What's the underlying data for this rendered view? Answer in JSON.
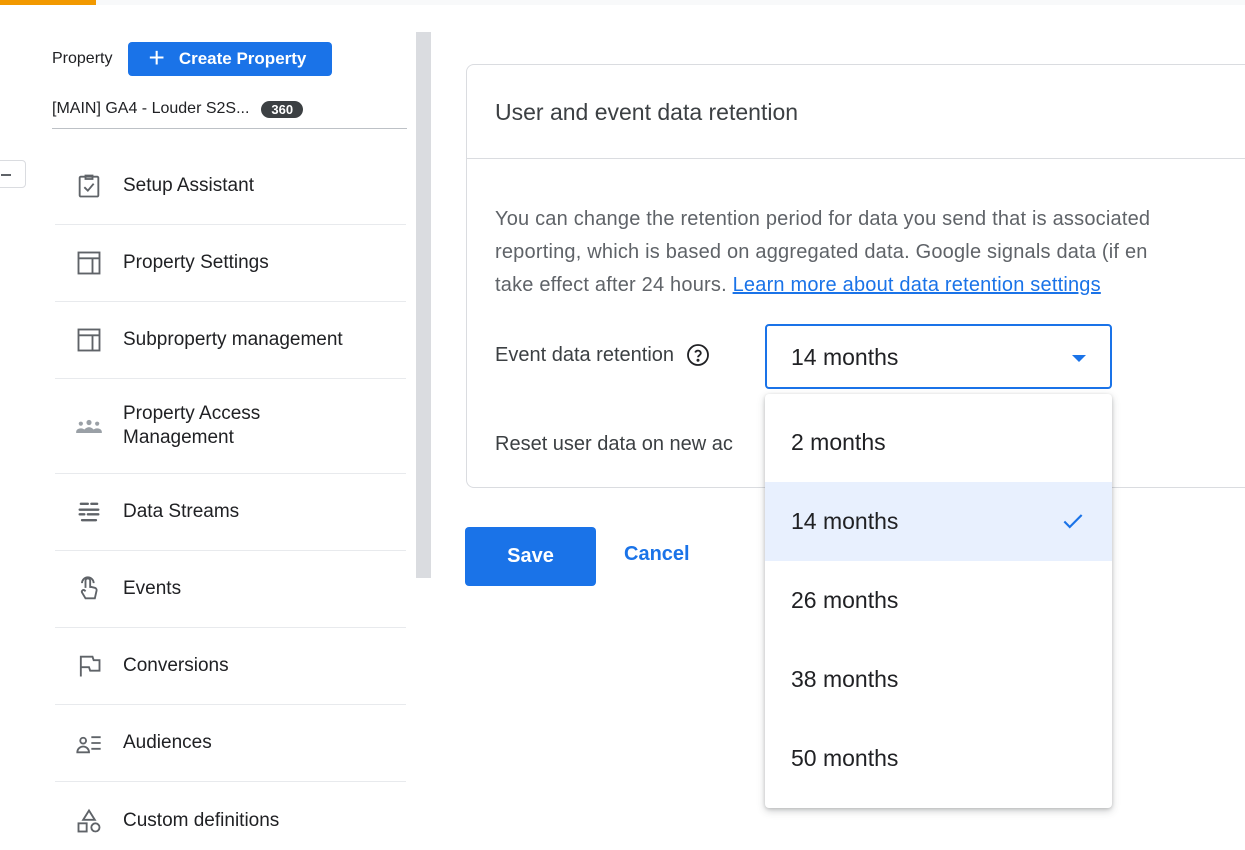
{
  "sidebar": {
    "property_label": "Property",
    "create_property_label": "Create Property",
    "property_name": "[MAIN] GA4 - Louder S2S...",
    "property_badge": "360",
    "items": [
      {
        "label": "Setup Assistant",
        "icon": "clipboard-check-icon"
      },
      {
        "label": "Property Settings",
        "icon": "layout-icon"
      },
      {
        "label": "Subproperty management",
        "icon": "layout-icon"
      },
      {
        "label": "Property Access Management",
        "icon": "people-icon"
      },
      {
        "label": "Data Streams",
        "icon": "data-streams-icon"
      },
      {
        "label": "Events",
        "icon": "touch-icon"
      },
      {
        "label": "Conversions",
        "icon": "flag-icon"
      },
      {
        "label": "Audiences",
        "icon": "audiences-icon"
      },
      {
        "label": "Custom definitions",
        "icon": "shapes-icon"
      }
    ]
  },
  "card": {
    "title": "User and event data retention",
    "description_line1": "You can change the retention period for data you send that is associated",
    "description_line2": "reporting, which is based on aggregated data. Google signals data (if en",
    "description_line3_prefix": "take effect after 24 hours. ",
    "learn_more_link": "Learn more about data retention settings",
    "event_retention_label": "Event data retention",
    "reset_label": "Reset user data on new ac"
  },
  "select": {
    "value": "14 months",
    "options": [
      "2 months",
      "14 months",
      "26 months",
      "38 months",
      "50 months"
    ],
    "selected_index": 1
  },
  "actions": {
    "save_label": "Save",
    "cancel_label": "Cancel"
  },
  "colors": {
    "accent": "#1a73e8",
    "selected_bg": "#e8f0fe",
    "top_accent": "#f29900"
  }
}
